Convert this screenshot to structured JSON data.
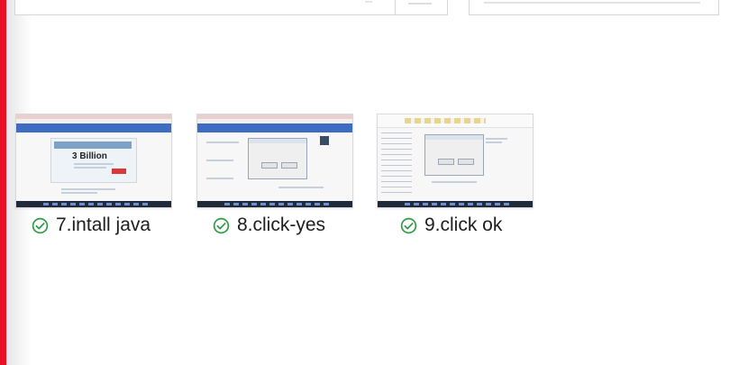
{
  "files": [
    {
      "name": "7.intall java",
      "status": "synced",
      "thumbnail_text": "3 Billion"
    },
    {
      "name": "8.click-yes",
      "status": "synced"
    },
    {
      "name": "9.click ok",
      "status": "synced"
    }
  ],
  "colors": {
    "selection_bar": "#e81123",
    "sync_check": "#2e9b43",
    "label_text": "#1e1e1e"
  },
  "icons": {
    "status": "check-circle-icon"
  }
}
